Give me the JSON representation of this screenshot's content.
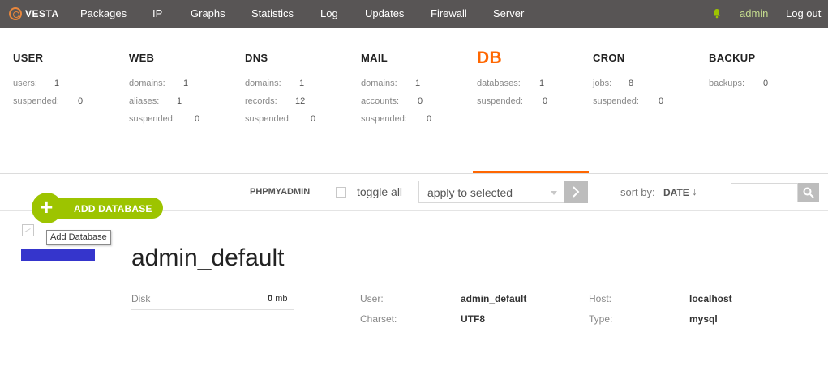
{
  "topnav": {
    "logo_text": "VESTA",
    "items": [
      "Packages",
      "IP",
      "Graphs",
      "Statistics",
      "Log",
      "Updates",
      "Firewall",
      "Server"
    ],
    "user": "admin",
    "logout": "Log out",
    "bell_icon": "bell-icon",
    "admin_color": "#c4db8e"
  },
  "stats": {
    "user": {
      "title": "USER",
      "rows": [
        {
          "label": "users:",
          "value": "1"
        },
        {
          "label": "suspended:",
          "value": "0"
        }
      ]
    },
    "web": {
      "title": "WEB",
      "rows": [
        {
          "label": "domains:",
          "value": "1"
        },
        {
          "label": "aliases:",
          "value": "1"
        },
        {
          "label": "suspended:",
          "value": "0"
        }
      ]
    },
    "dns": {
      "title": "DNS",
      "rows": [
        {
          "label": "domains:",
          "value": "1"
        },
        {
          "label": "records:",
          "value": "12"
        },
        {
          "label": "suspended:",
          "value": "0"
        }
      ]
    },
    "mail": {
      "title": "MAIL",
      "rows": [
        {
          "label": "domains:",
          "value": "1"
        },
        {
          "label": "accounts:",
          "value": "0"
        },
        {
          "label": "suspended:",
          "value": "0"
        }
      ]
    },
    "db": {
      "title": "DB",
      "rows": [
        {
          "label": "databases:",
          "value": "1"
        },
        {
          "label": "suspended:",
          "value": "0"
        }
      ]
    },
    "cron": {
      "title": "CRON",
      "rows": [
        {
          "label": "jobs:",
          "value": "8"
        },
        {
          "label": "suspended:",
          "value": "0"
        }
      ]
    },
    "backup": {
      "title": "BACKUP",
      "rows": [
        {
          "label": "backups:",
          "value": "0"
        }
      ]
    },
    "accent_color": "#ff6701"
  },
  "toolbar": {
    "add_button": "ADD DATABASE",
    "tooltip": "Add Database",
    "phpmyadmin": "PHPMYADMIN",
    "toggle_all": "toggle all",
    "apply_select": "apply to selected",
    "sort_by": "sort by:",
    "sort_value": "DATE",
    "sort_arrow": "↓",
    "add_color": "#9dc400"
  },
  "database": {
    "name": "admin_default",
    "disk_label": "Disk",
    "disk_value": "0",
    "disk_unit": "mb",
    "user_label": "User:",
    "user_value": "admin_default",
    "charset_label": "Charset:",
    "charset_value": "UTF8",
    "host_label": "Host:",
    "host_value": "localhost",
    "type_label": "Type:",
    "type_value": "mysql",
    "status_color": "#3535cc"
  }
}
